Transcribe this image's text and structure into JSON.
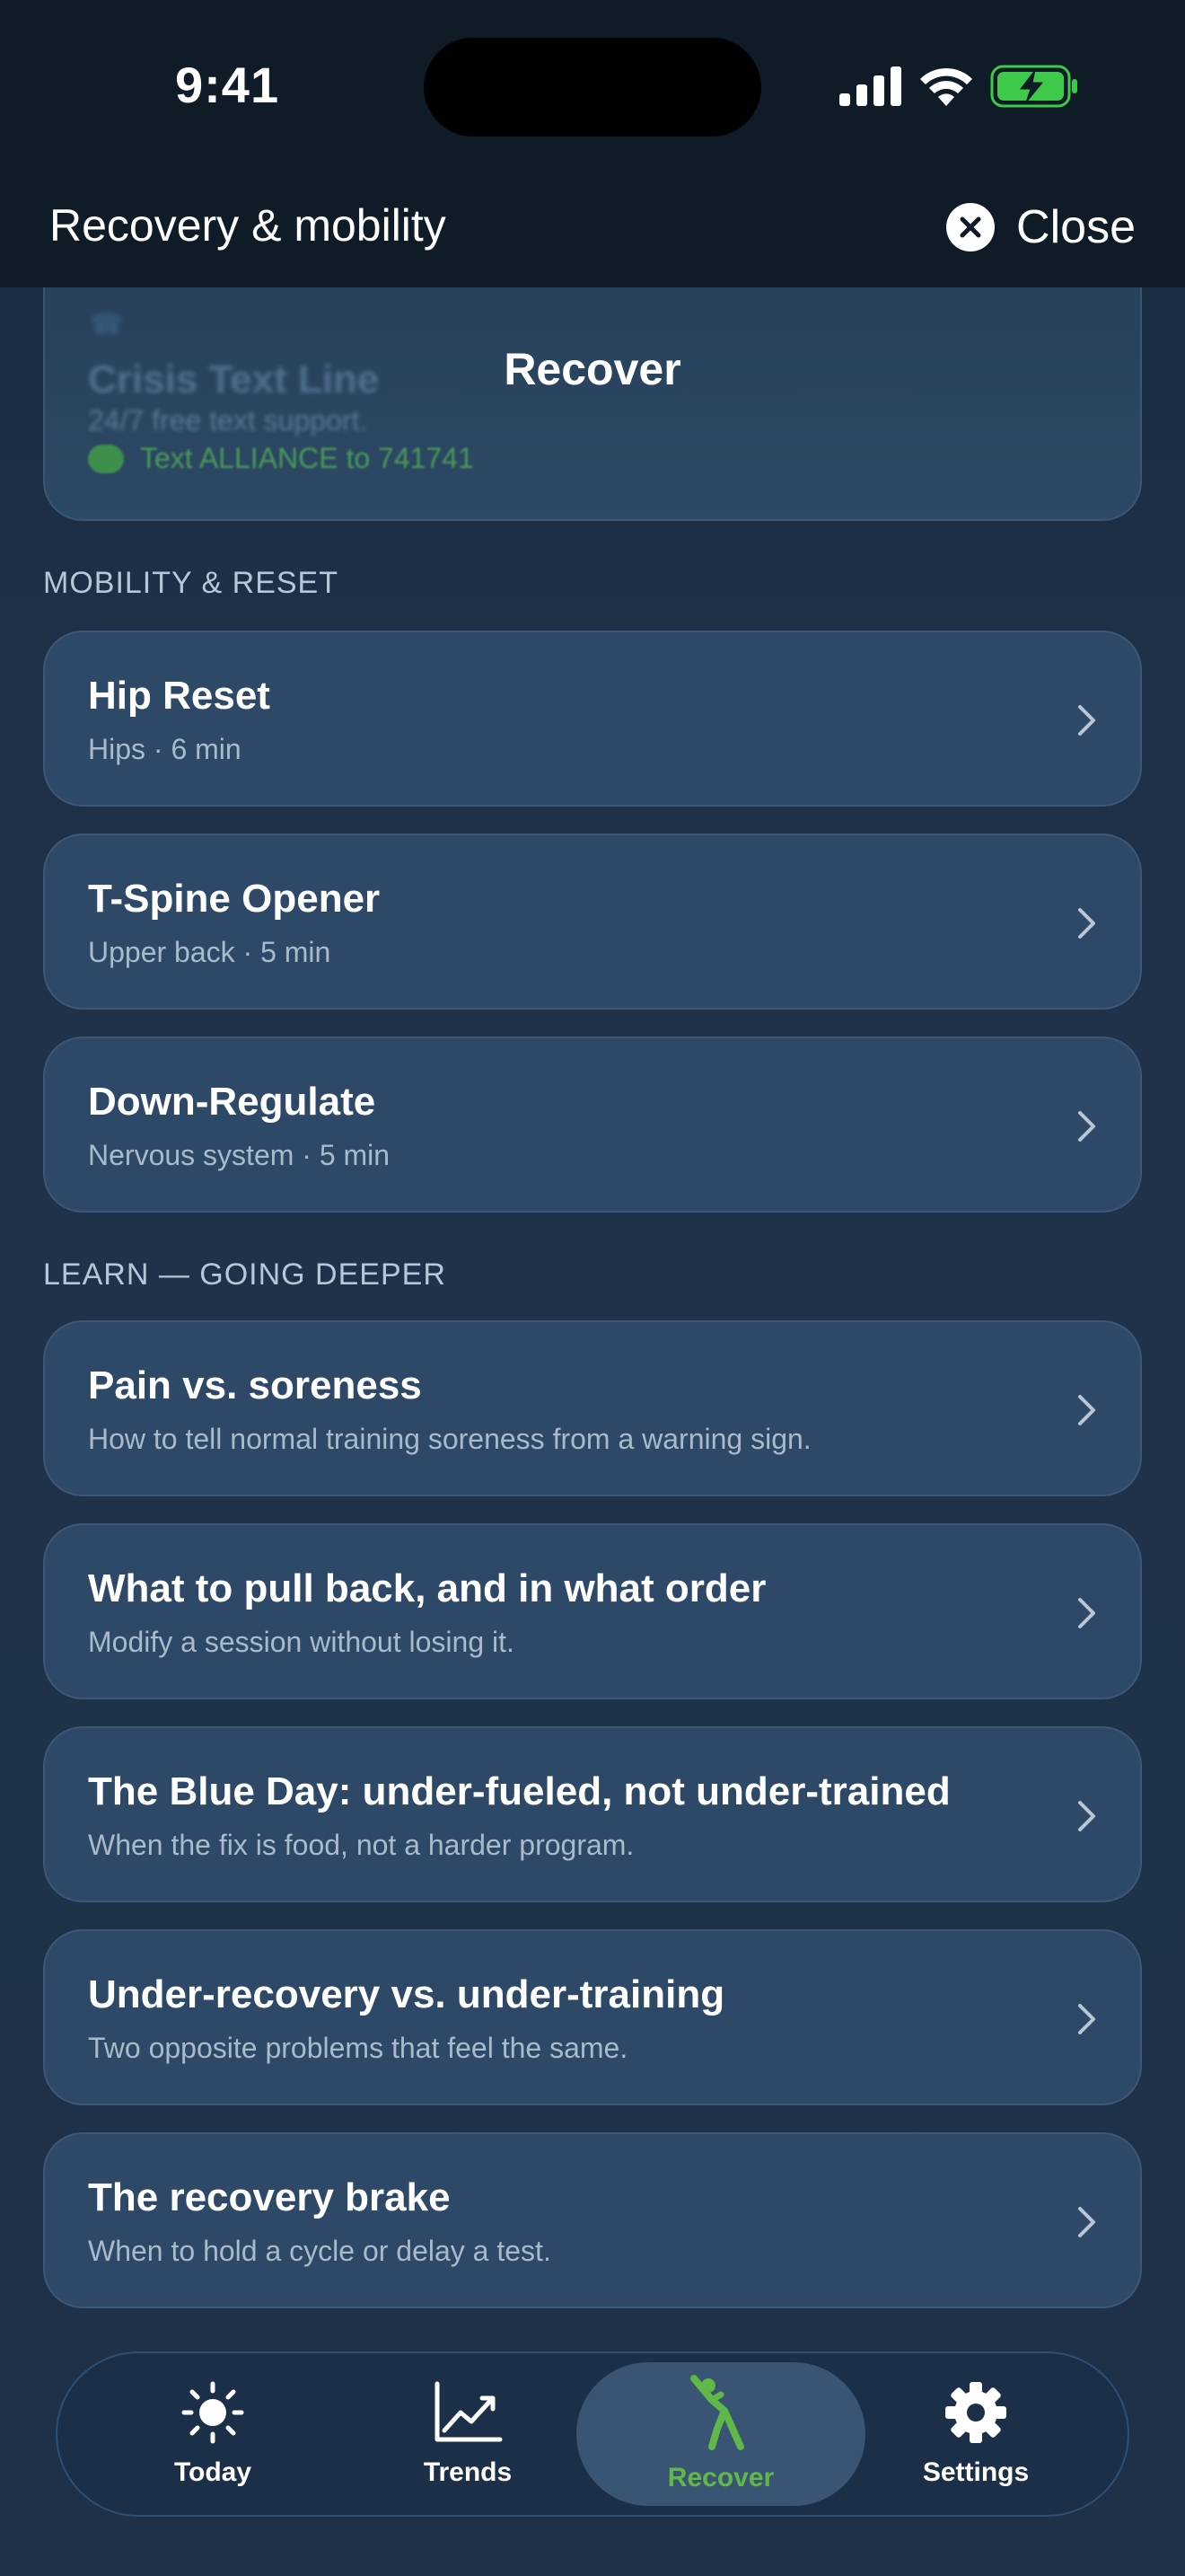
{
  "status_bar": {
    "time": "9:41"
  },
  "header": {
    "title": "Recovery & mobility",
    "close_label": "Close"
  },
  "page_title": "Recover",
  "crisis_card": {
    "name": "Crisis Text Line",
    "subtitle": "24/7 free text support.",
    "action": "Text ALLIANCE to 741741"
  },
  "sections": {
    "mobility": {
      "label": "MOBILITY & RESET",
      "items": [
        {
          "title": "Hip Reset",
          "subtitle": "Hips · 6 min"
        },
        {
          "title": "T-Spine Opener",
          "subtitle": "Upper back · 5 min"
        },
        {
          "title": "Down-Regulate",
          "subtitle": "Nervous system · 5 min"
        }
      ]
    },
    "learn": {
      "label": "LEARN — GOING DEEPER",
      "items": [
        {
          "title": "Pain vs. soreness",
          "subtitle": "How to tell normal training soreness from a warning sign."
        },
        {
          "title": "What to pull back, and in what order",
          "subtitle": "Modify a session without losing it."
        },
        {
          "title": "The Blue Day: under-fueled, not under-trained",
          "subtitle": "When the fix is food, not a harder program."
        },
        {
          "title": "Under-recovery vs. under-training",
          "subtitle": "Two opposite problems that feel the same."
        },
        {
          "title": "The recovery brake",
          "subtitle": "When to hold a cycle or delay a test."
        }
      ]
    }
  },
  "tabs": [
    {
      "label": "Today",
      "icon": "sun-icon"
    },
    {
      "label": "Trends",
      "icon": "trend-chart-icon"
    },
    {
      "label": "Recover",
      "icon": "stretch-figure-icon",
      "active": true
    },
    {
      "label": "Settings",
      "icon": "gear-icon"
    }
  ],
  "colors": {
    "accent_green": "#5fb847",
    "card_bg": "#2e4967",
    "header_bg": "#101b28",
    "battery_green": "#3fc94a"
  }
}
